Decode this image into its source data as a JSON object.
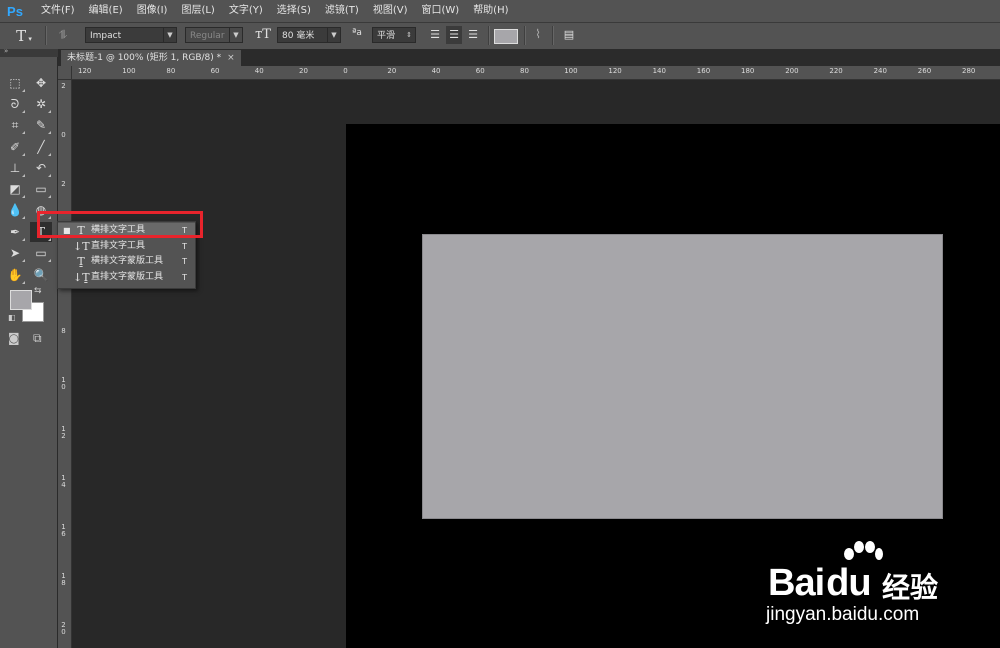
{
  "app": {
    "logo": "Ps"
  },
  "menu": [
    "文件(F)",
    "编辑(E)",
    "图像(I)",
    "图层(L)",
    "文字(Y)",
    "选择(S)",
    "滤镜(T)",
    "视图(V)",
    "窗口(W)",
    "帮助(H)"
  ],
  "options": {
    "tool_glyph": "T",
    "font_family": "Impact",
    "font_style": "Regular",
    "font_size": "80 毫米",
    "aa_label": "ªa",
    "antialias": "平滑"
  },
  "document": {
    "tab_title": "未标题-1 @ 100% (矩形 1, RGB/8) *",
    "close": "×"
  },
  "ruler": {
    "top_labels": [
      "120",
      "100",
      "80",
      "60",
      "40",
      "20",
      "0",
      "20",
      "40",
      "60",
      "80",
      "100",
      "120",
      "140",
      "160",
      "180",
      "200",
      "220",
      "240",
      "260",
      "280"
    ],
    "left_labels": [
      "2",
      "0",
      "2",
      "4",
      "6",
      "8",
      "10",
      "12",
      "14",
      "16",
      "18",
      "20"
    ]
  },
  "flyout": {
    "items": [
      {
        "label": "横排文字工具",
        "key": "T",
        "icon": "horizontal-type-icon",
        "active": true
      },
      {
        "label": "直排文字工具",
        "key": "T",
        "icon": "vertical-type-icon",
        "active": false
      },
      {
        "label": "横排文字蒙版工具",
        "key": "T",
        "icon": "horizontal-type-mask-icon",
        "active": false
      },
      {
        "label": "直排文字蒙版工具",
        "key": "T",
        "icon": "vertical-type-mask-icon",
        "active": false
      }
    ]
  },
  "colors": {
    "foreground": "#a7a6aa",
    "background": "#ffffff",
    "highlight": "#e8242c"
  },
  "watermark": {
    "brand": "Bai",
    "brand2": "du",
    "cn": "经验",
    "url": "jingyan.baidu.com"
  }
}
